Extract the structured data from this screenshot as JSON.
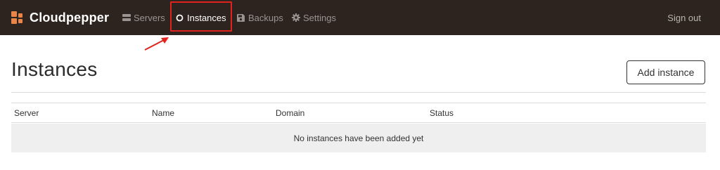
{
  "brand": {
    "name": "Cloudpepper",
    "accent": "#e8864a"
  },
  "navbar": {
    "background": "#2e241f",
    "items": [
      {
        "label": "Servers",
        "icon": "server-icon"
      },
      {
        "label": "Instances",
        "icon": "circle-icon",
        "active": true
      },
      {
        "label": "Backups",
        "icon": "floppy-disk-icon"
      },
      {
        "label": "Settings",
        "icon": "gear-icon"
      }
    ],
    "signout_label": "Sign out"
  },
  "annotation": {
    "highlight_color": "#e0231c"
  },
  "page": {
    "title": "Instances",
    "add_button_label": "Add instance"
  },
  "table": {
    "columns": [
      "Server",
      "Name",
      "Domain",
      "Status"
    ],
    "empty_message": "No instances have been added yet"
  }
}
